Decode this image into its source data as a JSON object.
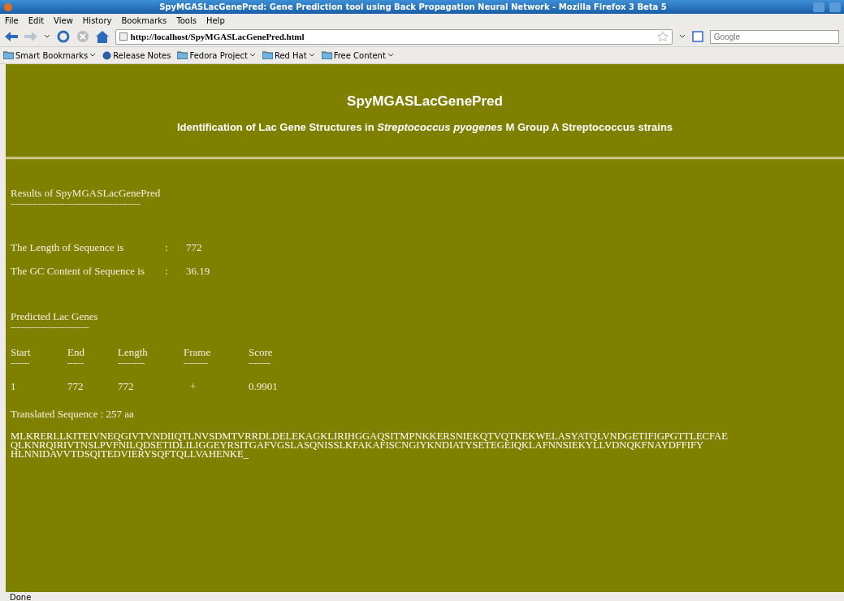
{
  "window": {
    "title": "SpyMGASLacGenePred: Gene Prediction tool using Back Propagation Neural Network - Mozilla Firefox 3 Beta 5"
  },
  "menu": [
    "File",
    "Edit",
    "View",
    "History",
    "Bookmarks",
    "Tools",
    "Help"
  ],
  "address_bar": {
    "value": "http://localhost/SpyMGASLacGenePred.html"
  },
  "search": {
    "placeholder": "Google"
  },
  "bookmarks": [
    {
      "label": "Smart Bookmarks",
      "kind": "folder-menu"
    },
    {
      "label": "Release Notes",
      "kind": "link"
    },
    {
      "label": "Fedora Project",
      "kind": "folder-menu"
    },
    {
      "label": "Red Hat",
      "kind": "folder-menu"
    },
    {
      "label": "Free Content",
      "kind": "folder-menu"
    }
  ],
  "page": {
    "title": "SpyMGASLacGenePred",
    "subtitle": "Identification of Lac Gene Structures in *Streptococcus pyogenes* M Group A Streptococcus strains",
    "results_heading": "Results of SpyMGASLacGenePred",
    "results_rule": "------------------------------------------------",
    "stats": [
      {
        "label": "The Length of Sequence is",
        "sep": ":",
        "value": "772"
      },
      {
        "label": "The GC Content of Sequence is",
        "sep": ":",
        "value": "36.19"
      }
    ],
    "genes_heading": "Predicted Lac Genes",
    "genes_rule": "-----------------------------",
    "table": {
      "columns": [
        {
          "label": "Start",
          "rule": "-------"
        },
        {
          "label": "End",
          "rule": "------"
        },
        {
          "label": "Length",
          "rule": "----------"
        },
        {
          "label": "Frame",
          "rule": "---------"
        },
        {
          "label": "Score",
          "rule": "--------"
        }
      ],
      "rows": [
        [
          "1",
          "772",
          "772",
          "+",
          "0.9901"
        ]
      ]
    },
    "translated": "Translated Sequence :  257 aa",
    "sequence": [
      "MLKRERLLKITEIVNEQGIVTVNDIIQTLNVSDMTVRRDLDELEKAGKLIRIHGGAQSITMPNKKERSNIEKQTVQTKEKWELASYATQLVNDGETIFIGPGTTLECFAE",
      "QLKNRQIRIVTNSLPVFNILQDSETIDLILIGGEYRSITGAFVGSLASQNISSLKFAKAFISCNGIYKNDIATYSETEGEIQKLAFNNSIEKYLLVDNQKFNAYDFFIFY",
      "HLNNIDAVVTDSQITEDVIERYSQFTQLLVAHENKE_"
    ]
  },
  "status_bar": "Done"
}
